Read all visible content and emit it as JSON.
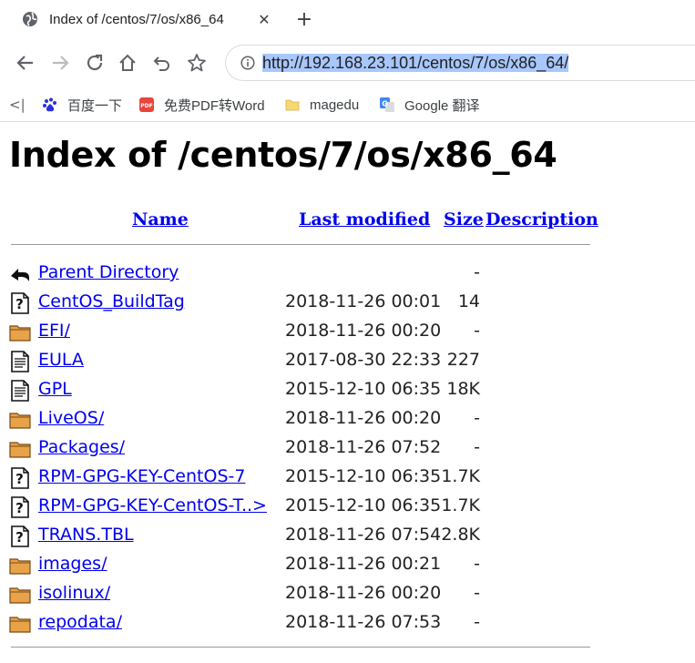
{
  "tab": {
    "title": "Index of /centos/7/os/x86_64"
  },
  "toolbar": {
    "url_prefix": "http://192.168.23.101",
    "url_path": "/centos/7/os/x86_64/"
  },
  "bookmarks": [
    {
      "label": "百度一下",
      "icon": "baidu-icon"
    },
    {
      "label": "免费PDF转Word",
      "icon": "pdf-icon"
    },
    {
      "label": "magedu",
      "icon": "folder-icon"
    },
    {
      "label": "Google 翻译",
      "icon": "google-translate-icon"
    }
  ],
  "page": {
    "heading": "Index of /centos/7/os/x86_64",
    "columns": {
      "name": "Name",
      "modified": "Last modified",
      "size": "Size",
      "description": "Description"
    },
    "entries": [
      {
        "name": "Parent Directory",
        "date": "",
        "size": "-",
        "icon": "back-icon"
      },
      {
        "name": "CentOS_BuildTag",
        "date": "2018-11-26 00:01",
        "size": "14",
        "icon": "unknown-file-icon"
      },
      {
        "name": "EFI/",
        "date": "2018-11-26 00:20",
        "size": "-",
        "icon": "folder-icon"
      },
      {
        "name": "EULA",
        "date": "2017-08-30 22:33",
        "size": "227",
        "icon": "text-file-icon"
      },
      {
        "name": "GPL",
        "date": "2015-12-10 06:35",
        "size": "18K",
        "icon": "text-file-icon"
      },
      {
        "name": "LiveOS/",
        "date": "2018-11-26 00:20",
        "size": "-",
        "icon": "folder-icon"
      },
      {
        "name": "Packages/",
        "date": "2018-11-26 07:52",
        "size": "-",
        "icon": "folder-icon"
      },
      {
        "name": "RPM-GPG-KEY-CentOS-7",
        "date": "2015-12-10 06:35",
        "size": "1.7K",
        "icon": "unknown-file-icon"
      },
      {
        "name": "RPM-GPG-KEY-CentOS-T..>",
        "date": "2015-12-10 06:35",
        "size": "1.7K",
        "icon": "unknown-file-icon"
      },
      {
        "name": "TRANS.TBL",
        "date": "2018-11-26 07:54",
        "size": "2.8K",
        "icon": "unknown-file-icon"
      },
      {
        "name": "images/",
        "date": "2018-11-26 00:21",
        "size": "-",
        "icon": "folder-icon"
      },
      {
        "name": "isolinux/",
        "date": "2018-11-26 00:20",
        "size": "-",
        "icon": "folder-icon"
      },
      {
        "name": "repodata/",
        "date": "2018-11-26 07:53",
        "size": "-",
        "icon": "folder-icon"
      }
    ]
  },
  "colors": {
    "link": "#0000ee",
    "url_selection": "#a8c7fa"
  }
}
